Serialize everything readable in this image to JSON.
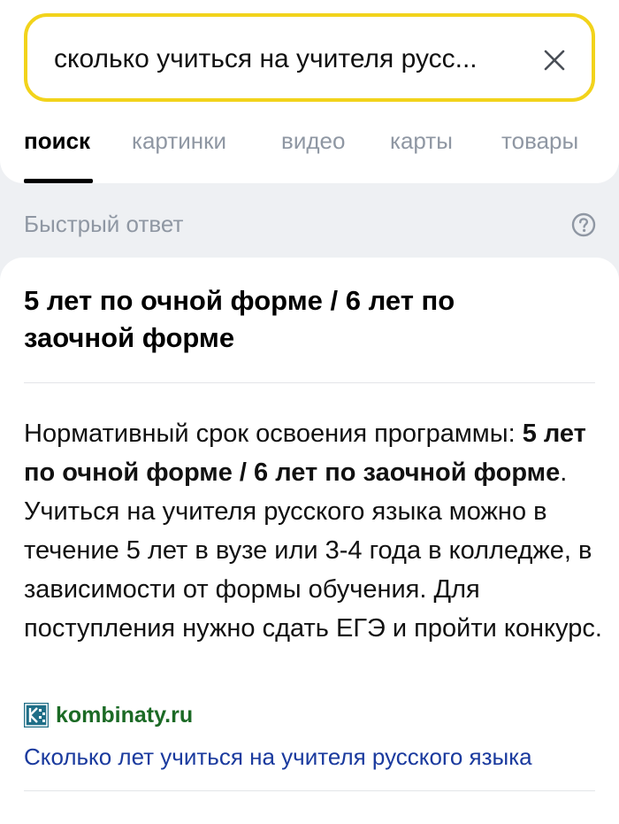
{
  "search": {
    "query": "сколько учиться на учителя русс..."
  },
  "tabs": [
    {
      "label": "поиск",
      "active": true
    },
    {
      "label": "картинки",
      "active": false
    },
    {
      "label": "видео",
      "active": false
    },
    {
      "label": "карты",
      "active": false
    },
    {
      "label": "товары",
      "active": false
    }
  ],
  "quick_answer": {
    "section_title": "Быстрый ответ",
    "heading": "5 лет по очной форме / 6 лет по заочной форме",
    "body_prefix": "Нормативный срок освоения программы: ",
    "body_bold": "5 лет по очной форме / 6 лет по заочной форме",
    "body_suffix": ". Учиться на учителя русского языка можно в течение 5 лет в вузе или 3-4 года в колледже, в зависимости от формы обучения. Для поступления нужно сдать ЕГЭ и пройти конкурс.",
    "source_domain": "kombinaty.ru",
    "source_title": "Сколько лет учиться на учителя русского языка"
  },
  "colors": {
    "search_border": "#f2d31b",
    "tab_inactive": "#8f97a3",
    "source_domain": "#1b6a25",
    "link": "#1a3a9e",
    "page_background": "#eef0f3"
  },
  "icons": {
    "clear": "close-icon",
    "help": "help-icon",
    "favicon": "kombinaty-favicon-icon"
  }
}
